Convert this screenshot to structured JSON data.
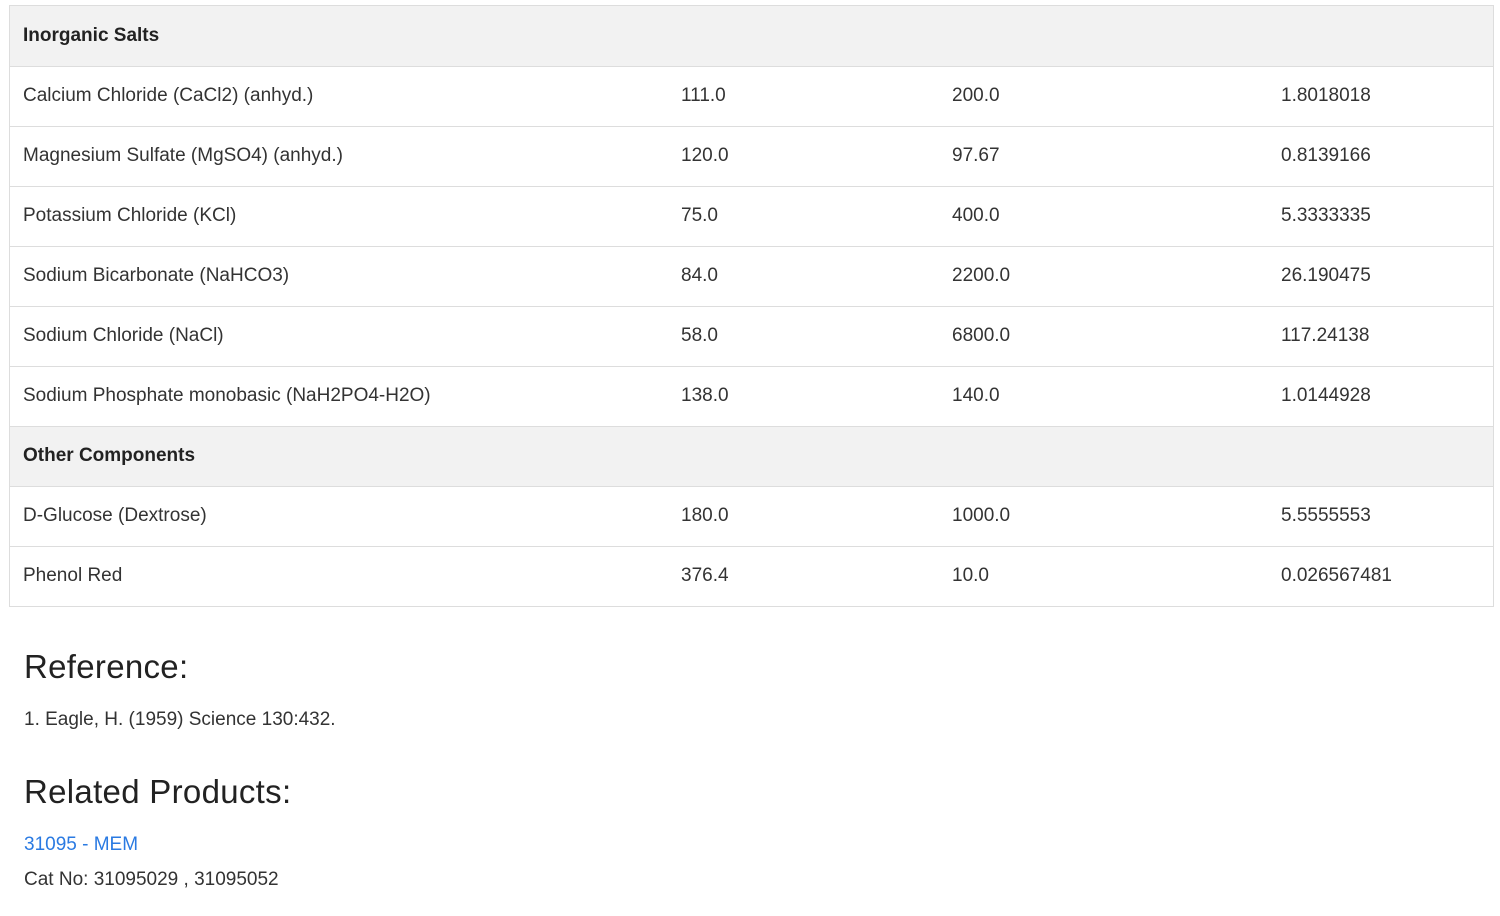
{
  "table": {
    "rows": [
      {
        "type": "group",
        "label": "Inorganic Salts"
      },
      {
        "type": "item",
        "name": "Calcium Chloride (CaCl2) (anhyd.)",
        "mw": "111.0",
        "conc": "200.0",
        "mm": "1.8018018"
      },
      {
        "type": "item",
        "name": "Magnesium Sulfate (MgSO4) (anhyd.)",
        "mw": "120.0",
        "conc": "97.67",
        "mm": "0.8139166"
      },
      {
        "type": "item",
        "name": "Potassium Chloride (KCl)",
        "mw": "75.0",
        "conc": "400.0",
        "mm": "5.3333335"
      },
      {
        "type": "item",
        "name": "Sodium Bicarbonate (NaHCO3)",
        "mw": "84.0",
        "conc": "2200.0",
        "mm": "26.190475"
      },
      {
        "type": "item",
        "name": "Sodium Chloride (NaCl)",
        "mw": "58.0",
        "conc": "6800.0",
        "mm": "117.24138"
      },
      {
        "type": "item",
        "name": "Sodium Phosphate monobasic (NaH2PO4-H2O)",
        "mw": "138.0",
        "conc": "140.0",
        "mm": "1.0144928"
      },
      {
        "type": "group",
        "label": "Other Components"
      },
      {
        "type": "item",
        "name": "D-Glucose (Dextrose)",
        "mw": "180.0",
        "conc": "1000.0",
        "mm": "5.5555553"
      },
      {
        "type": "item",
        "name": "Phenol Red",
        "mw": "376.4",
        "conc": "10.0",
        "mm": "0.026567481"
      }
    ]
  },
  "reference": {
    "heading": "Reference:",
    "items": [
      "1. Eagle, H. (1959) Science 130:432."
    ]
  },
  "related": {
    "heading": "Related Products:",
    "product_link": "31095 - MEM",
    "cat_no": "Cat No: 31095029 , 31095052"
  }
}
